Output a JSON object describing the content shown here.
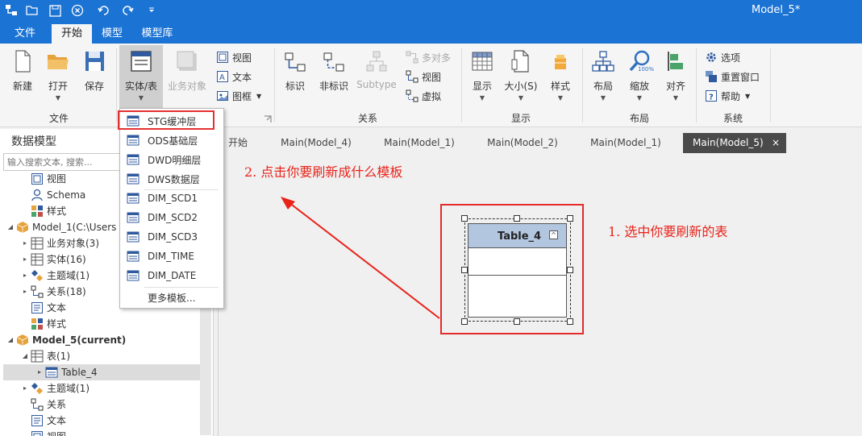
{
  "window": {
    "title": "Model_5*"
  },
  "menu": {
    "tabs": [
      {
        "label": "文件"
      },
      {
        "label": "开始"
      },
      {
        "label": "模型"
      },
      {
        "label": "模型库"
      }
    ]
  },
  "ribbon": {
    "file_group": {
      "label": "文件",
      "new": "新建",
      "open": "打开",
      "save": "保存"
    },
    "entity_group": {
      "entity_table": "实体/表",
      "business_object": "业务对象",
      "view": "视图",
      "text": "文本",
      "frame": "图框"
    },
    "relation_group": {
      "label": "关系",
      "identifying": "标识",
      "non_identifying": "非标识",
      "subtype": "Subtype",
      "many_to_many": "多对多",
      "view": "视图",
      "virtual": "虚拟"
    },
    "display_group": {
      "label": "显示",
      "display": "显示",
      "size": "大小(S)",
      "style": "样式"
    },
    "layout_group": {
      "label": "布局",
      "layout": "布局",
      "zoom": "缩放",
      "zoom_badge": "100%",
      "align": "对齐"
    },
    "system_group": {
      "label": "系统",
      "options": "选项",
      "reset_window": "重置窗口",
      "help": "帮助"
    }
  },
  "dropdown": {
    "items": [
      {
        "label": "STG缓冲层"
      },
      {
        "label": "ODS基础层"
      },
      {
        "label": "DWD明细层"
      },
      {
        "label": "DWS数据层"
      },
      {
        "label": "DIM_SCD1"
      },
      {
        "label": "DIM_SCD2"
      },
      {
        "label": "DIM_SCD3"
      },
      {
        "label": "DIM_TIME"
      },
      {
        "label": "DIM_DATE"
      }
    ],
    "more": "更多模板..."
  },
  "left_panel": {
    "title": "数据模型",
    "search_placeholder": "输入搜索文本, 搜索...",
    "tree": [
      {
        "label": "视图"
      },
      {
        "label": "Schema"
      },
      {
        "label": "样式"
      },
      {
        "label": "Model_1(C:\\Users"
      },
      {
        "label": "业务对象(3)"
      },
      {
        "label": "实体(16)"
      },
      {
        "label": "主题域(1)"
      },
      {
        "label": "关系(18)"
      },
      {
        "label": "文本"
      },
      {
        "label": "样式"
      },
      {
        "label": "Model_5(current)"
      },
      {
        "label": "表(1)"
      },
      {
        "label": "Table_4"
      },
      {
        "label": "主题域(1)"
      },
      {
        "label": "关系"
      },
      {
        "label": "文本"
      },
      {
        "label": "视图"
      }
    ]
  },
  "doc_tabs": [
    {
      "label": "开始"
    },
    {
      "label": "Main(Model_4)"
    },
    {
      "label": "Main(Model_1)"
    },
    {
      "label": "Main(Model_2)"
    },
    {
      "label": "Main(Model_1)"
    },
    {
      "label": "Main(Model_5)"
    }
  ],
  "doc_tab_close": "×",
  "canvas": {
    "annotation_step2": "2. 点击你要刷新成什么模板",
    "annotation_step1": "1. 选中你要刷新的表",
    "entity": {
      "name": "Table_4",
      "collapse": "^"
    }
  },
  "colors": {
    "title_bar": "#1b73d3",
    "annotation_red": "#e8231a",
    "entity_header": "#b3c6e0",
    "active_doc_tab": "#4a4a4a"
  }
}
